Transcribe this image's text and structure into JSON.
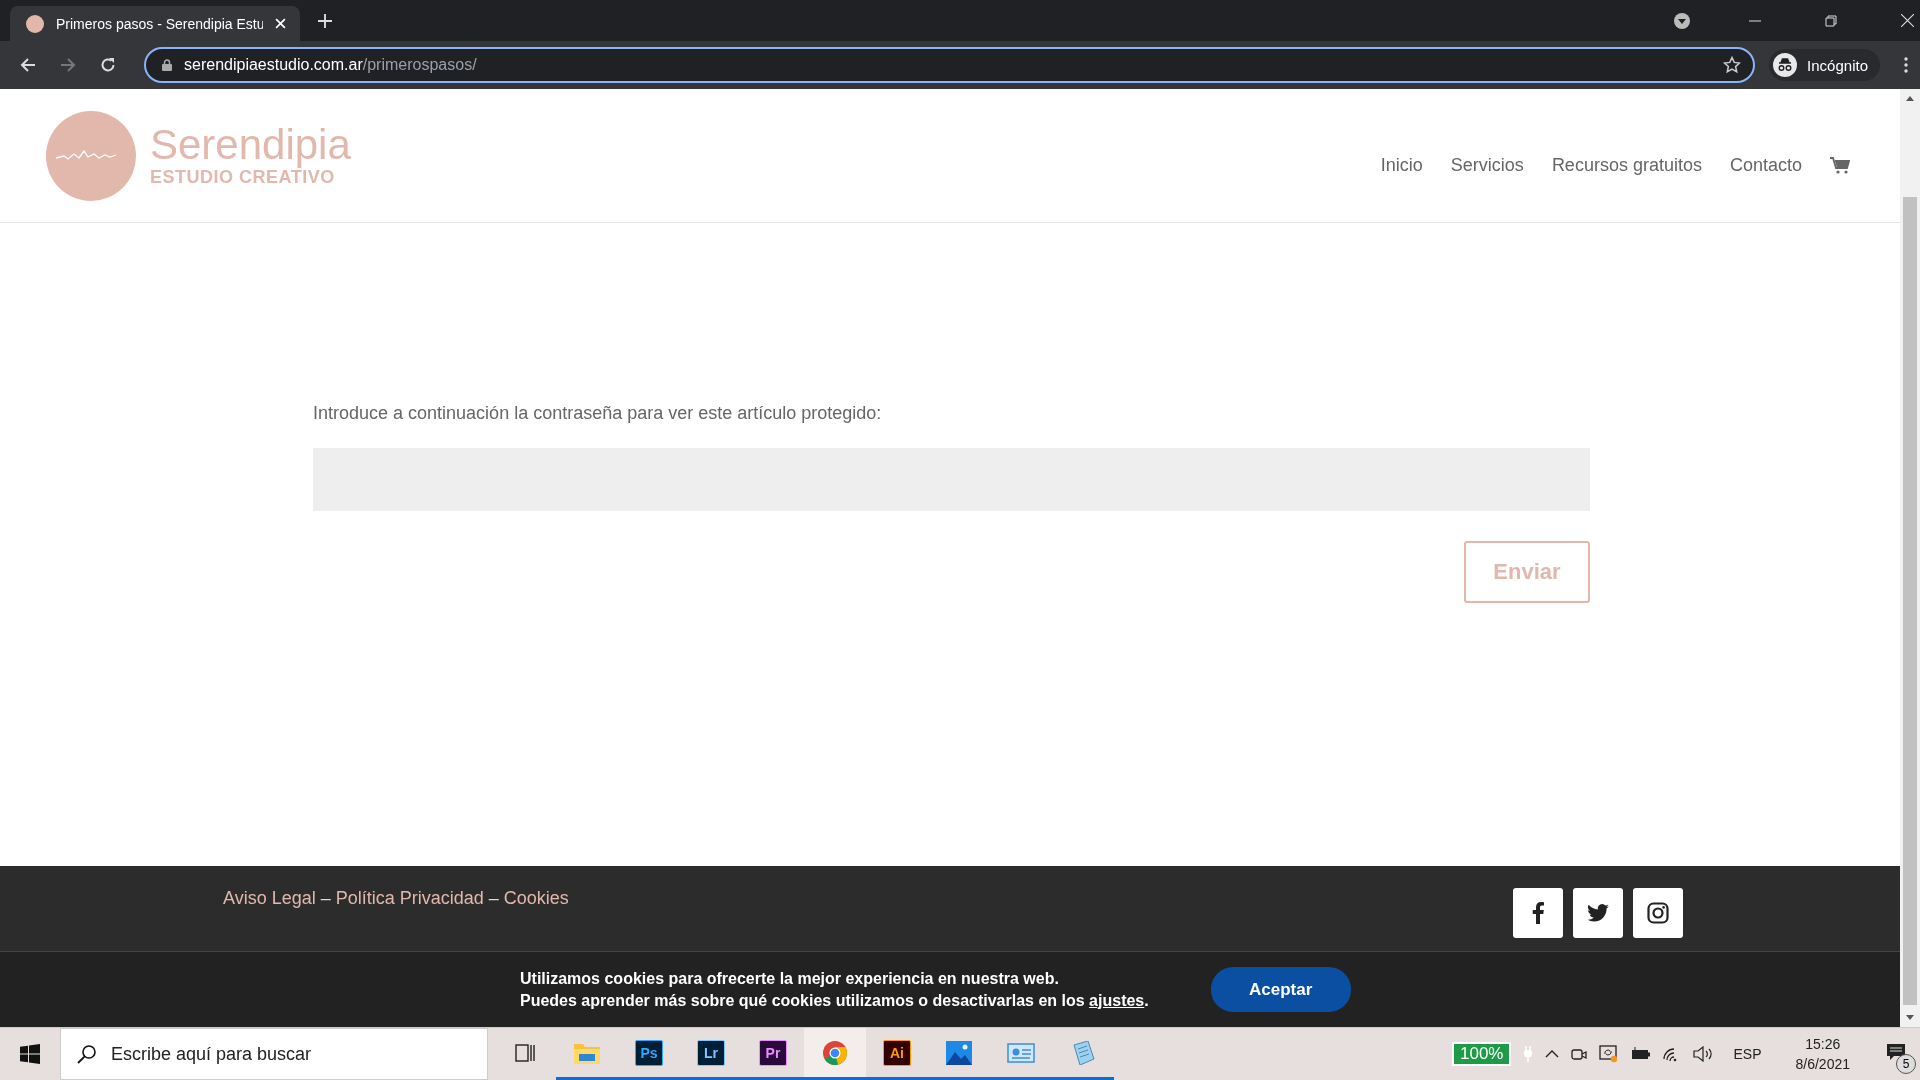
{
  "browser": {
    "tab_title": "Primeros pasos - Serendipia Estu",
    "url_host": "serendipiaestudio.com.ar",
    "url_path": "/primerospasos/",
    "profile": "Incógnito"
  },
  "site": {
    "logo_name": "Serendipia",
    "logo_tagline": "ESTUDIO CREATIVO",
    "nav": [
      {
        "label": "Inicio"
      },
      {
        "label": "Servicios"
      },
      {
        "label": "Recursos gratuitos"
      },
      {
        "label": "Contacto"
      }
    ]
  },
  "form": {
    "prompt": "Introduce a continuación la contraseña para ver este artículo protegido:",
    "submit": "Enviar"
  },
  "footer": {
    "items": [
      {
        "kind": "link",
        "text": "Aviso Legal"
      },
      {
        "kind": "separator",
        "text": "–"
      },
      {
        "kind": "link",
        "text": "Política Privacidad"
      },
      {
        "kind": "separator",
        "text": "–"
      },
      {
        "kind": "link",
        "text": "Cookies"
      }
    ],
    "social": [
      {
        "kind": "facebook"
      },
      {
        "kind": "twitter"
      },
      {
        "kind": "instagram"
      }
    ]
  },
  "cookie_banner": {
    "line1": "Utilizamos cookies para ofrecerte la mejor experiencia en nuestra web.",
    "line2_before": "Puedes aprender más sobre qué cookies utilizamos o desactivarlas en los",
    "link": "ajustes",
    "line2_after": ".",
    "button": "Aceptar"
  },
  "taskbar": {
    "search_placeholder": "Escribe aquí para buscar",
    "apps": [
      {
        "kind": "taskview",
        "running": false,
        "selected": false
      },
      {
        "kind": "files",
        "running": true,
        "selected": false
      },
      {
        "kind": "badge",
        "label": "Ps",
        "running": true,
        "selected": false
      },
      {
        "kind": "badge",
        "label": "Lr",
        "running": true,
        "selected": false
      },
      {
        "kind": "badge",
        "label": "Pr",
        "running": true,
        "selected": false
      },
      {
        "kind": "chrome",
        "running": true,
        "selected": true
      },
      {
        "kind": "badge",
        "label": "Ai",
        "running": true,
        "selected": false
      },
      {
        "kind": "photos",
        "running": true,
        "selected": false
      },
      {
        "kind": "card",
        "running": true,
        "selected": false
      },
      {
        "kind": "notepad",
        "running": true,
        "selected": false
      }
    ],
    "battery": "100%",
    "language": "ESP",
    "time": "15:26",
    "date": "8/6/2021",
    "notifications": "5"
  }
}
